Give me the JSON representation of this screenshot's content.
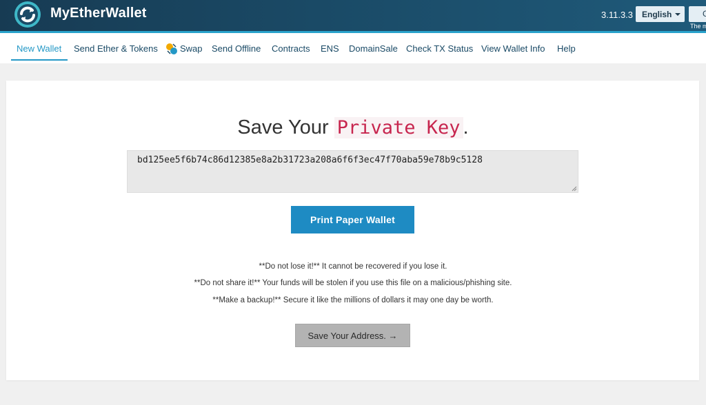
{
  "header": {
    "brand": "MyEtherWallet",
    "version": "3.11.3.3",
    "language": "English",
    "gas_button": "G",
    "gas_note": "The m"
  },
  "nav": {
    "items": [
      {
        "label": "New Wallet",
        "active": true
      },
      {
        "label": "Send Ether & Tokens"
      },
      {
        "label": "Swap",
        "icon": "swap-icon"
      },
      {
        "label": "Send Offline"
      },
      {
        "label": "Contracts"
      },
      {
        "label": "ENS"
      },
      {
        "label": "DomainSale"
      },
      {
        "label": "Check TX Status"
      },
      {
        "label": "View Wallet Info"
      },
      {
        "label": "Help"
      }
    ]
  },
  "main": {
    "title_prefix": "Save Your",
    "title_code": "Private Key",
    "title_suffix": ".",
    "private_key": "bd125ee5f6b74c86d12385e8a2b31723a208a6f6f3ec47f70aba59e78b9c5128",
    "print_button": "Print Paper Wallet",
    "warnings": [
      "**Do not lose it!** It cannot be recovered if you lose it.",
      "**Do not share it!** Your funds will be stolen if you use this file on a malicious/phishing site.",
      "**Make a backup!** Secure it like the millions of dollars it may one day be worth."
    ],
    "save_address_button": "Save Your Address. →"
  },
  "colors": {
    "header_bg": "#173b53",
    "accent": "#2498c6",
    "print_button": "#1e8bc3",
    "code_text": "#c7254e"
  }
}
